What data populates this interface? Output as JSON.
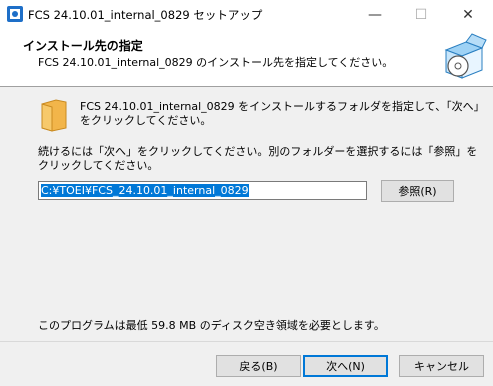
{
  "window": {
    "title": "FCS 24.10.01_internal_0829 セットアップ",
    "minimize": "—",
    "maximize": "☐",
    "close": "✕"
  },
  "header": {
    "title": "インストール先の指定",
    "subtitle": "FCS 24.10.01_internal_0829 のインストール先を指定してください。"
  },
  "main": {
    "intro": "FCS 24.10.01_internal_0829 をインストールするフォルダを指定して、「次へ」をクリックしてください。",
    "instructions": "続けるには「次へ」をクリックしてください。別のフォルダーを選択するには「参照」をクリックしてください。",
    "path_value": "C:¥TOEI¥FCS_24.10.01_internal_0829",
    "browse_label": "参照(R)",
    "space_required": "このプログラムは最低 59.8 MB のディスク空き領域を必要とします。"
  },
  "footer": {
    "back_label": "戻る(B)",
    "next_label": "次へ(N)",
    "cancel_label": "キャンセル"
  },
  "colors": {
    "accent": "#0078d7",
    "background": "#f0f0f0"
  },
  "icons": {
    "app": "installer-icon",
    "folder": "folder-icon",
    "header_art": "box-disc-icon"
  }
}
